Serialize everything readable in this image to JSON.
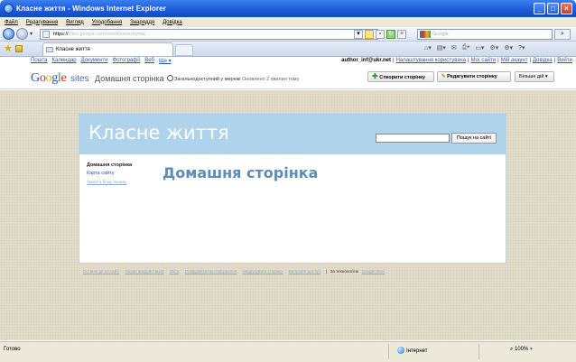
{
  "window": {
    "title": "Класне життя - Windows Internet Explorer",
    "min": "_",
    "max": "□",
    "close": "×"
  },
  "menu": [
    "Файл",
    "Редагування",
    "Вигляд",
    "Уподобання",
    "Знаряддя",
    "Довідка"
  ],
  "address": {
    "url_prefix": "https://",
    "url_host": "sites.google.com",
    "url_path": "/site/klasnezhyttia/",
    "search_placeholder": "Google"
  },
  "tab": {
    "label": "Класне життя"
  },
  "gbar": {
    "links": [
      "Пошта",
      "Календар",
      "Документи",
      "Фотографії",
      "Веб",
      "Ще ▾"
    ],
    "email": "author_inf@ukr.net",
    "right_links": [
      "Налаштування користувача",
      "Мої сайти",
      "Мій акаунт",
      "Довідка",
      "Вийти"
    ]
  },
  "header": {
    "logo_g1": "G",
    "logo_o1": "o",
    "logo_o2": "o",
    "logo_g2": "g",
    "logo_l": "l",
    "logo_e": "e",
    "sites": "sites",
    "page_name": "Домашня сторінка",
    "shared": "Загальнодоступний у мережі",
    "edited": "Оновлено 2 хвилин тому",
    "create_button": "Створити сторінку",
    "edit_button": "Редагувати сторінку",
    "more_button": "Більше дій ▾"
  },
  "site": {
    "title": "Класне життя",
    "search_button": "Пошук на сайті",
    "nav": {
      "home": "Домашня сторінка",
      "sitemap": "Карта сайту",
      "edit_sidebar": "Змінити бічну панель"
    },
    "page_title": "Домашня сторінка"
  },
  "footer": {
    "links": [
      "Останні дії на сайті",
      "Умови використання",
      "Звіти",
      "Повідомити про порушення",
      "Надрукувати сторінку",
      "Вилучити доступ"
    ],
    "powered_text": "За технологією",
    "powered_link": "Google Sites"
  },
  "status": {
    "text": "Готово",
    "zone": "Інтернет",
    "zoom": "100%"
  }
}
